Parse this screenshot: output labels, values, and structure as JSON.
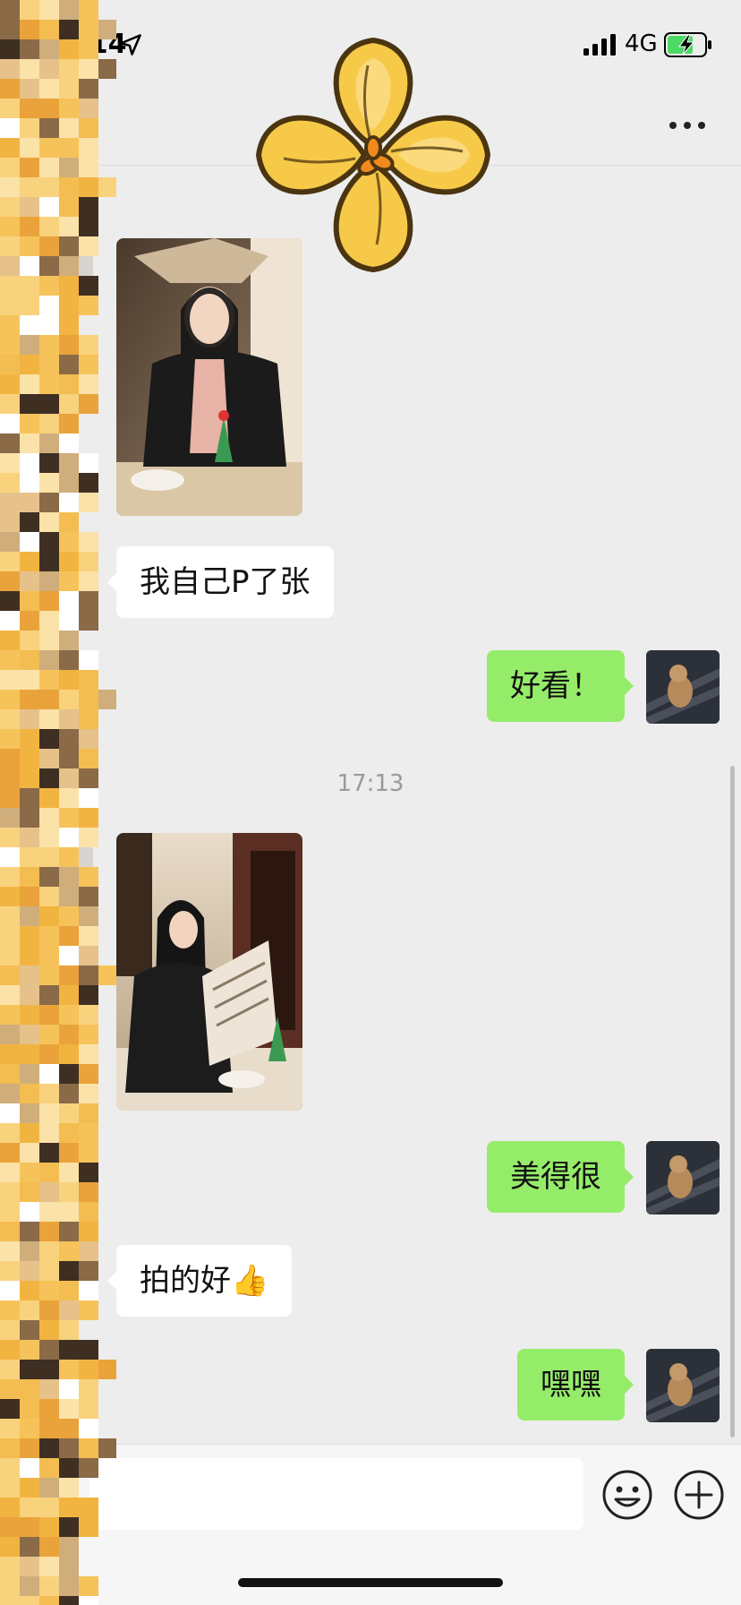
{
  "status_bar": {
    "time": "17:14",
    "network": "4G"
  },
  "chat": {
    "timestamp": "17:13",
    "messages": [
      {
        "id": "m1",
        "side": "in",
        "type": "image",
        "description": "photo"
      },
      {
        "id": "m2",
        "side": "in",
        "type": "text",
        "text": "我自己P了张"
      },
      {
        "id": "m3",
        "side": "out",
        "type": "text",
        "text": "好看！"
      },
      {
        "id": "m4",
        "side": "in",
        "type": "image",
        "description": "photo"
      },
      {
        "id": "m5",
        "side": "out",
        "type": "text",
        "text": "美得很"
      },
      {
        "id": "m6",
        "side": "in",
        "type": "text",
        "text": "拍的好👍"
      },
      {
        "id": "m7",
        "side": "out",
        "type": "text",
        "text": "嘿嘿"
      }
    ]
  },
  "input_bar": {
    "placeholder": ""
  },
  "colors": {
    "background": "#ededed",
    "outgoing_bubble": "#95ec69",
    "incoming_bubble": "#ffffff",
    "battery_charge": "#4cd964"
  },
  "icons": {
    "status": [
      "location-arrow-icon",
      "signal-icon",
      "battery-charging-icon"
    ],
    "nav": [
      "back-icon",
      "more-icon"
    ],
    "input": [
      "voice-icon",
      "emoji-icon",
      "plus-icon"
    ]
  }
}
